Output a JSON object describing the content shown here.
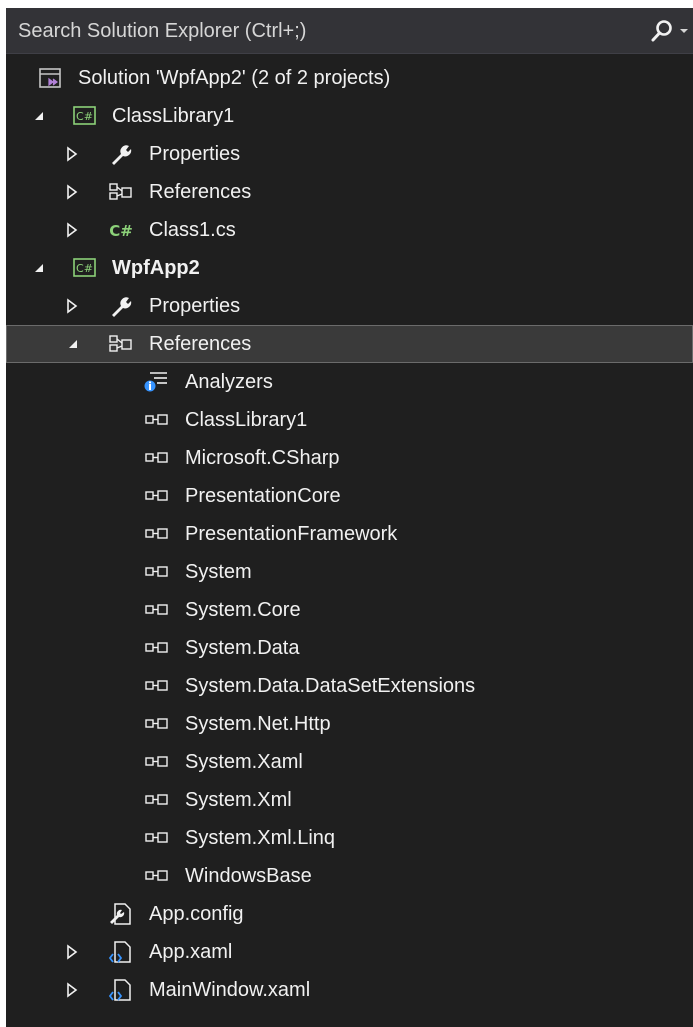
{
  "search": {
    "placeholder": "Search Solution Explorer (Ctrl+;)"
  },
  "tree": {
    "solution": {
      "label": "Solution 'WpfApp2' (2 of 2 projects)"
    },
    "classlibrary1": {
      "label": "ClassLibrary1",
      "properties": "Properties",
      "references": "References",
      "class1": "Class1.cs"
    },
    "wpfapp2": {
      "label": "WpfApp2",
      "properties": "Properties",
      "references": "References",
      "analyzers": "Analyzers",
      "refs": [
        "ClassLibrary1",
        "Microsoft.CSharp",
        "PresentationCore",
        "PresentationFramework",
        "System",
        "System.Core",
        "System.Data",
        "System.Data.DataSetExtensions",
        "System.Net.Http",
        "System.Xaml",
        "System.Xml",
        "System.Xml.Linq",
        "WindowsBase"
      ],
      "app_config": "App.config",
      "app_xaml": "App.xaml",
      "mainwindow": "MainWindow.xaml"
    }
  },
  "colors": {
    "background": "#1f1f1f",
    "csharp_green": "#8cd179",
    "selection": "#3a3a3a",
    "search_bg": "#333337"
  }
}
